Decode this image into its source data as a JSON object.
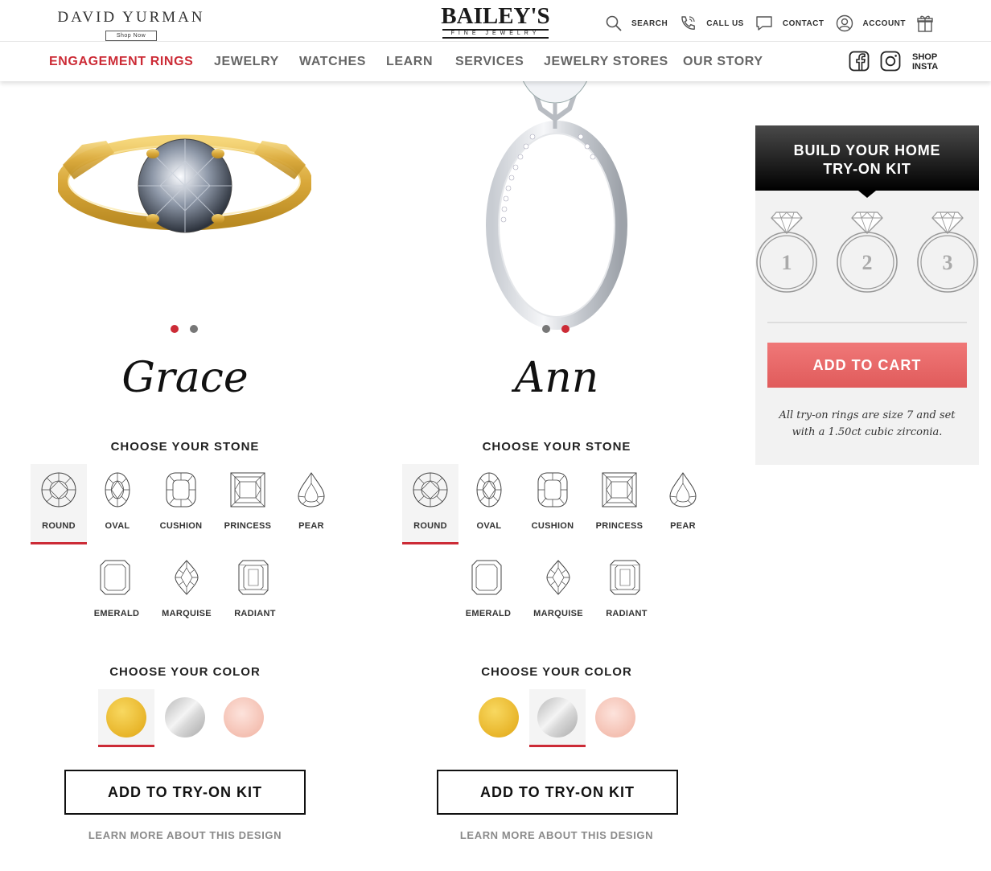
{
  "header": {
    "partner_logo": "DAVID YURMAN",
    "partner_cta": "Shop Now",
    "brand_name": "BAILEY'S",
    "brand_sub": "FINE JEWELRY",
    "utilities": [
      {
        "icon": "search-icon",
        "label": "SEARCH"
      },
      {
        "icon": "phone-icon",
        "label": "CALL US"
      },
      {
        "icon": "chat-bubble-icon",
        "label": "CONTACT"
      },
      {
        "icon": "account-icon",
        "label": "ACCOUNT"
      },
      {
        "icon": "gift-icon",
        "label": ""
      }
    ]
  },
  "nav": {
    "items": [
      "ENGAGEMENT RINGS",
      "JEWELRY",
      "WATCHES",
      "LEARN",
      "SERVICES",
      "JEWELRY STORES",
      "OUR STORY"
    ],
    "active_index": 0,
    "social": [
      "facebook-icon",
      "instagram-icon"
    ],
    "shop_insta": [
      "SHOP",
      "INSTA"
    ]
  },
  "products": [
    {
      "name": "Grace",
      "metal": "yellow gold",
      "slide_active": 1,
      "slide_count": 2,
      "stone_title": "CHOOSE YOUR STONE",
      "stones": [
        "ROUND",
        "OVAL",
        "CUSHION",
        "PRINCESS",
        "PEAR",
        "EMERALD",
        "MARQUISE",
        "RADIANT"
      ],
      "stone_selected": "ROUND",
      "color_title": "CHOOSE YOUR COLOR",
      "colors": [
        "yellow-gold",
        "white-gold",
        "rose-gold"
      ],
      "color_selected": "yellow-gold",
      "button": "ADD TO TRY-ON KIT",
      "learn": "LEARN MORE ABOUT THIS DESIGN"
    },
    {
      "name": "Ann",
      "metal": "white gold",
      "slide_active": 2,
      "slide_count": 2,
      "stone_title": "CHOOSE YOUR STONE",
      "stones": [
        "ROUND",
        "OVAL",
        "CUSHION",
        "PRINCESS",
        "PEAR",
        "EMERALD",
        "MARQUISE",
        "RADIANT"
      ],
      "stone_selected": "ROUND",
      "color_title": "CHOOSE YOUR COLOR",
      "colors": [
        "yellow-gold",
        "white-gold",
        "rose-gold"
      ],
      "color_selected": "white-gold",
      "button": "ADD TO TRY-ON KIT",
      "learn": "LEARN MORE ABOUT THIS DESIGN"
    }
  ],
  "kit": {
    "title": [
      "BUILD YOUR HOME",
      "TRY-ON KIT"
    ],
    "slots": [
      "1",
      "2",
      "3"
    ],
    "cart_button": "ADD TO CART",
    "note": "All try-on rings are size 7 and set with a 1.50ct cubic zirconia."
  },
  "colors": {
    "accent_red": "#cc2b36",
    "cart_red": "#e56565",
    "yellow_gold": "#f0c33c",
    "white_gold": "#d6d6d6",
    "rose_gold": "#f5c4b6"
  }
}
